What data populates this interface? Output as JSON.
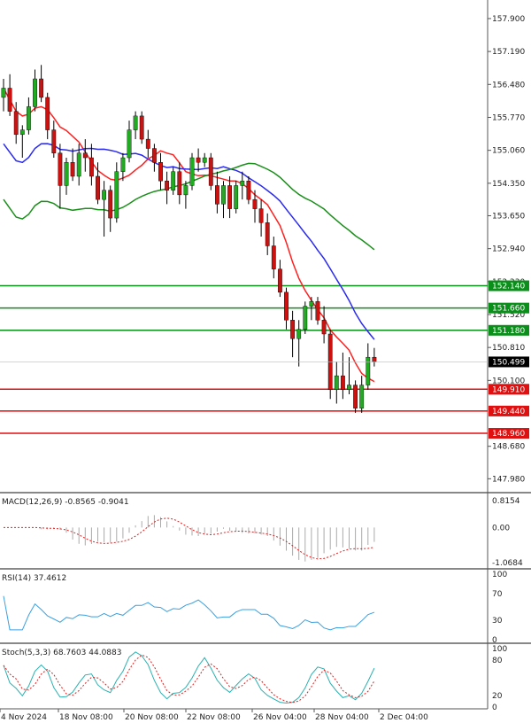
{
  "chart_data": {
    "type": "candlestick",
    "instrument_note": "",
    "x_labels": [
      "4 Nov 2024",
      "18 Nov 08:00",
      "20 Nov 08:00",
      "22 Nov 08:00",
      "26 Nov 04:00",
      "28 Nov 04:00",
      "2 Dec 04:00"
    ],
    "price_axis": {
      "ticks": [
        "157.900",
        "157.190",
        "156.480",
        "155.770",
        "155.060",
        "154.350",
        "153.650",
        "152.940",
        "152.230",
        "151.520",
        "150.810",
        "150.100",
        "148.680",
        "147.980"
      ],
      "range": [
        147.7,
        158.3
      ]
    },
    "current_price": "150.499",
    "levels": [
      {
        "value": 152.14,
        "label": "152.140",
        "color": "#0a8f1a"
      },
      {
        "value": 151.66,
        "label": "151.660",
        "color": "#0a8f1a"
      },
      {
        "value": 151.18,
        "label": "151.180",
        "color": "#0a8f1a"
      },
      {
        "value": 149.91,
        "label": "149.910",
        "color": "#e01010"
      },
      {
        "value": 149.44,
        "label": "149.440",
        "color": "#e01010"
      },
      {
        "value": 148.96,
        "label": "148.960",
        "color": "#e01010"
      }
    ],
    "candles": [
      [
        156.2,
        156.6,
        155.9,
        156.4
      ],
      [
        156.4,
        156.7,
        155.8,
        155.9
      ],
      [
        155.9,
        156.1,
        155.2,
        155.4
      ],
      [
        155.4,
        155.6,
        154.9,
        155.5
      ],
      [
        155.5,
        156.2,
        155.4,
        156.0
      ],
      [
        156.0,
        156.8,
        155.9,
        156.6
      ],
      [
        156.6,
        156.9,
        156.1,
        156.2
      ],
      [
        156.2,
        156.3,
        155.3,
        155.5
      ],
      [
        155.5,
        155.7,
        154.9,
        155.0
      ],
      [
        155.0,
        155.2,
        153.8,
        154.3
      ],
      [
        154.3,
        154.9,
        154.1,
        154.8
      ],
      [
        154.8,
        155.1,
        154.4,
        154.5
      ],
      [
        154.5,
        155.2,
        154.3,
        155.0
      ],
      [
        155.0,
        155.3,
        154.6,
        154.9
      ],
      [
        154.9,
        155.2,
        154.3,
        154.5
      ],
      [
        154.5,
        154.8,
        153.9,
        154.0
      ],
      [
        154.0,
        154.4,
        153.2,
        154.2
      ],
      [
        154.2,
        154.3,
        153.3,
        153.6
      ],
      [
        153.6,
        154.8,
        153.5,
        154.6
      ],
      [
        154.6,
        155.0,
        154.4,
        154.9
      ],
      [
        154.9,
        155.7,
        154.8,
        155.5
      ],
      [
        155.5,
        155.9,
        155.3,
        155.8
      ],
      [
        155.8,
        155.9,
        155.2,
        155.3
      ],
      [
        155.3,
        155.5,
        154.9,
        155.1
      ],
      [
        155.1,
        155.2,
        154.6,
        154.8
      ],
      [
        154.8,
        155.0,
        154.2,
        154.4
      ],
      [
        154.4,
        154.6,
        153.9,
        154.2
      ],
      [
        154.2,
        154.7,
        154.1,
        154.6
      ],
      [
        154.6,
        154.8,
        153.9,
        154.1
      ],
      [
        154.1,
        154.4,
        153.8,
        154.3
      ],
      [
        154.3,
        155.0,
        154.2,
        154.9
      ],
      [
        154.9,
        155.1,
        154.6,
        154.8
      ],
      [
        154.8,
        155.0,
        154.7,
        154.9
      ],
      [
        154.9,
        155.0,
        154.2,
        154.3
      ],
      [
        154.3,
        154.6,
        153.7,
        153.9
      ],
      [
        153.9,
        154.4,
        153.6,
        154.3
      ],
      [
        154.3,
        154.5,
        153.6,
        153.8
      ],
      [
        153.8,
        154.4,
        153.7,
        154.3
      ],
      [
        154.3,
        154.6,
        154.0,
        154.4
      ],
      [
        154.4,
        154.5,
        153.9,
        154.0
      ],
      [
        154.0,
        154.2,
        153.5,
        153.8
      ],
      [
        153.8,
        154.0,
        153.2,
        153.5
      ],
      [
        153.5,
        153.7,
        152.8,
        153.0
      ],
      [
        153.0,
        153.2,
        152.3,
        152.5
      ],
      [
        152.5,
        152.7,
        151.9,
        152.0
      ],
      [
        152.0,
        152.1,
        151.2,
        151.4
      ],
      [
        151.4,
        151.6,
        150.6,
        151.0
      ],
      [
        151.0,
        151.4,
        150.4,
        151.2
      ],
      [
        151.2,
        151.8,
        151.1,
        151.7
      ],
      [
        151.7,
        151.9,
        151.4,
        151.8
      ],
      [
        151.8,
        151.9,
        151.3,
        151.4
      ],
      [
        151.4,
        151.7,
        150.9,
        151.1
      ],
      [
        151.1,
        151.2,
        149.7,
        149.9
      ],
      [
        149.9,
        150.5,
        149.6,
        150.2
      ],
      [
        150.2,
        150.7,
        149.7,
        149.9
      ],
      [
        149.9,
        150.6,
        149.8,
        150.0
      ],
      [
        150.0,
        150.1,
        149.4,
        149.5
      ],
      [
        149.5,
        150.2,
        149.4,
        150.0
      ],
      [
        150.0,
        150.9,
        149.9,
        150.6
      ],
      [
        150.6,
        150.8,
        150.4,
        150.5
      ]
    ],
    "ma_red_label": "",
    "macd": {
      "title": "MACD(12,26,9) -0.8565 -0.9041",
      "ticks": [
        "0.8154",
        "0.00",
        "-1.0684"
      ],
      "range": [
        -1.2,
        0.95
      ]
    },
    "rsi": {
      "title": "RSI(14) 37.4612",
      "ticks": [
        "100",
        "70",
        "30",
        "0"
      ]
    },
    "stoch": {
      "title": "Stoch(5,3,3) 68.7603 44.0883",
      "ticks": [
        "100",
        "80",
        "20",
        "0"
      ]
    }
  }
}
